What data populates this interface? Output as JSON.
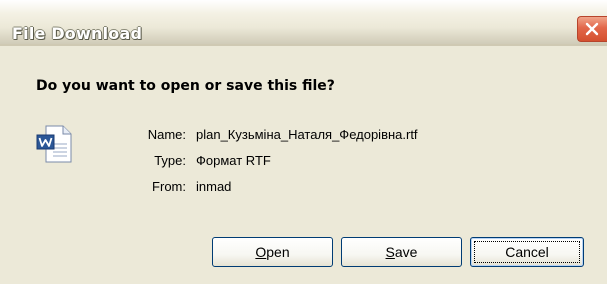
{
  "window": {
    "title": "File Download"
  },
  "dialog": {
    "question": "Do you want to open or save this file?",
    "file_icon": "word-document-icon",
    "fields": [
      {
        "label": "Name:",
        "value": "plan_Кузьміна_Наталя_Федорівна.rtf"
      },
      {
        "label": "Type:",
        "value": "Формат RTF"
      },
      {
        "label": "From:",
        "value": "inmad"
      }
    ]
  },
  "buttons": {
    "open": {
      "accel": "O",
      "rest": "pen"
    },
    "save": {
      "accel": "S",
      "rest": "ave"
    },
    "cancel": {
      "label": "Cancel"
    }
  },
  "colors": {
    "dialog_background": "#ECE9D8",
    "close_button": "#D4502F",
    "button_border": "#003C74"
  }
}
